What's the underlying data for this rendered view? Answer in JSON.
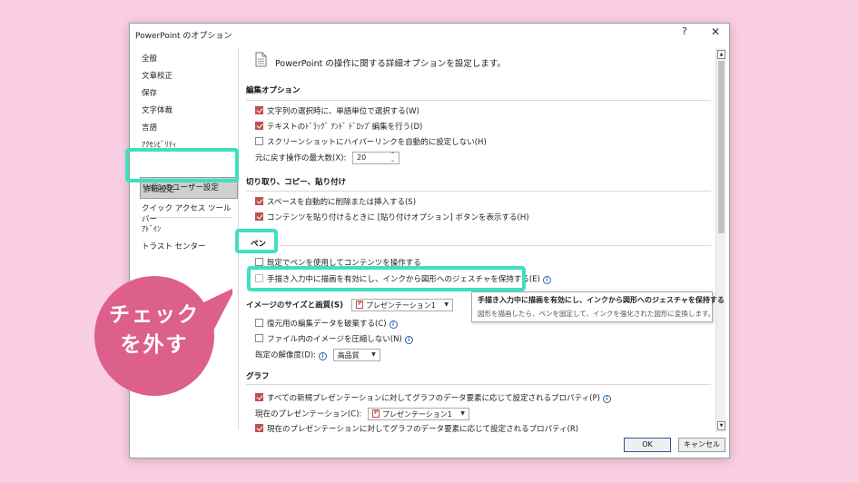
{
  "window": {
    "title": "PowerPoint のオプション",
    "help": "?",
    "close": "✕"
  },
  "sidebar": {
    "items": [
      "全般",
      "文章校正",
      "保存",
      "文字体裁",
      "言語",
      "ｱｸｾｼﾋﾞﾘﾃｨ",
      "詳細設定",
      "リボンのユーザー設定",
      "クイック アクセス ツール バー",
      "ｱﾄﾞｲﾝ",
      "トラスト センター"
    ],
    "selected": "詳細設定"
  },
  "content": {
    "header": "PowerPoint の操作に関する詳細オプションを設定します。",
    "edit": {
      "title": "編集オプション",
      "opt1": "文字列の選択時に、単語単位で選択する(W)",
      "opt2": "テキストのﾄﾞﾗｯｸﾞ ｱﾝﾄﾞ ﾄﾞﾛｯﾌﾟ編集を行う(D)",
      "opt3": "スクリーンショットにハイパーリンクを自動的に設定しない(H)",
      "undo_label": "元に戻す操作の最大数(X):",
      "undo_value": "20"
    },
    "clip": {
      "title": "切り取り、コピー、貼り付け",
      "opt1": "スペースを自動的に削除または挿入する(S)",
      "opt2": "コンテンツを貼り付けるときに [貼り付けオプション] ボタンを表示する(H)"
    },
    "pen": {
      "title": "ペン",
      "opt1": "既定でペンを使用してコンテンツを操作する",
      "opt2": "手描き入力中に描画を有効にし、インクから図形へのジェスチャを保持する(E)"
    },
    "image": {
      "title": "イメージのサイズと画質(S)",
      "presentation": "プレゼンテーション1",
      "opt1": "復元用の編集データを破棄する(C)",
      "opt2": "ファイル内のイメージを圧縮しない(N)",
      "res_label": "既定の解像度(D):",
      "res_value": "高品質"
    },
    "graph": {
      "title": "グラフ",
      "opt1": "すべての新規プレゼンテーションに対してグラフのデータ要素に応じて設定されるプロパティ(P)",
      "current_label": "現在のプレゼンテーション(C):",
      "current_value": "プレゼンテーション1",
      "opt2": "現在のプレゼンテーションに対してグラフのデータ要素に応じて設定されるプロパティ(R)"
    }
  },
  "tooltip": {
    "title": "手描き入力中に描画を有効にし、インクから図形へのジェスチャを保持する",
    "desc": "図形を描画したら、ペンを固定して、インクを強化された図形に変換します。"
  },
  "buttons": {
    "ok": "OK",
    "cancel": "キャンセル"
  },
  "callout": {
    "line1": "チェック",
    "line2": "を外す"
  },
  "colors": {
    "background": "#f9cde2",
    "highlight": "#3fe0c0",
    "callout": "#dd5f8b",
    "check": "#c0504d"
  }
}
